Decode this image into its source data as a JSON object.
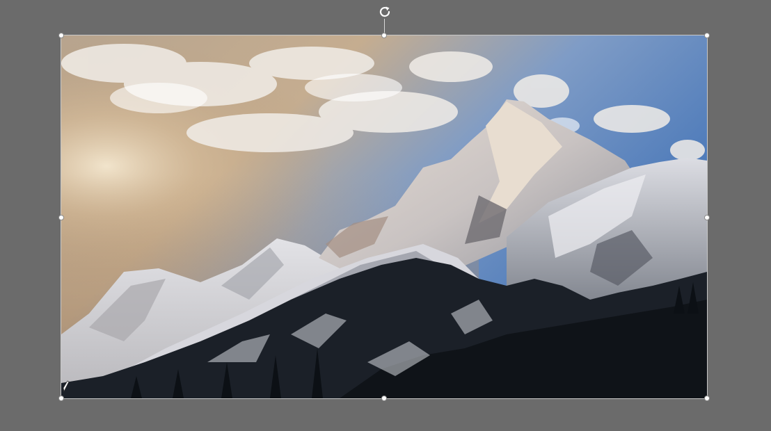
{
  "workspace": {
    "background_color": "#6b6b6b"
  },
  "selected_image": {
    "description_icon": "mountain-landscape-photo",
    "handle_color": "#ffffff",
    "outline_color": "#c8c8c8"
  },
  "handles": [
    "top-left",
    "top-center",
    "top-right",
    "middle-left",
    "middle-right",
    "bottom-left",
    "bottom-center",
    "bottom-right"
  ],
  "rotate_handle": {
    "icon": "rotate-icon"
  },
  "colors": {
    "sky_blue": "#3d6aa8",
    "sky_warm": "#c9a17a",
    "snow": "#e9e9ec",
    "rock_shadow": "#5d5f68",
    "forest": "#151a20"
  }
}
